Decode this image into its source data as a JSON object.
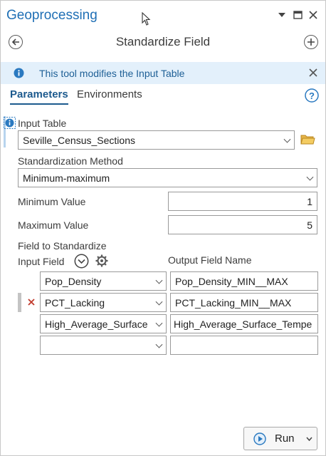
{
  "pane": {
    "title": "Geoprocessing",
    "tool_name": "Standardize Field",
    "info_message": "This tool modifies the Input Table"
  },
  "tabs": [
    {
      "label": "Parameters",
      "active": true
    },
    {
      "label": "Environments",
      "active": false
    }
  ],
  "params": {
    "input_table_label": "Input Table",
    "input_table_value": "Seville_Census_Sections",
    "method_label": "Standardization Method",
    "method_value": "Minimum-maximum",
    "min_label": "Minimum Value",
    "min_value": "1",
    "max_label": "Maximum Value",
    "max_value": "5",
    "field_section_label": "Field to Standardize",
    "input_field_header": "Input Field",
    "output_field_header": "Output Field Name"
  },
  "field_rows": [
    {
      "input": "Pop_Density",
      "output": "Pop_Density_MIN__MAX",
      "selected": false
    },
    {
      "input": "PCT_Lacking",
      "output": "PCT_Lacking_MIN__MAX",
      "selected": true
    },
    {
      "input": "High_Average_Surface",
      "output": "High_Average_Surface_Tempe",
      "selected": false
    },
    {
      "input": "",
      "output": "",
      "selected": false
    }
  ],
  "run_button": {
    "label": "Run"
  },
  "colors": {
    "accent": "#1f6fb5",
    "info_bg": "#e3f0fb",
    "delete_x": "#c0392b"
  }
}
